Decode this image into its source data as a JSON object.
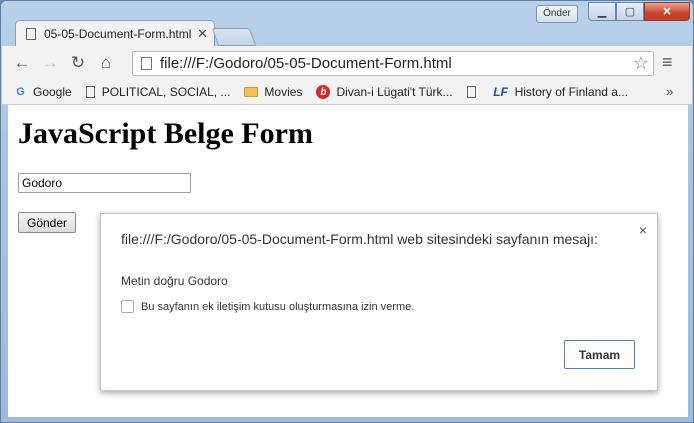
{
  "window": {
    "user_badge": "Önder",
    "min_glyph": "▁",
    "max_glyph": "▢",
    "close_glyph": "✕"
  },
  "tab": {
    "title": "05-05-Document-Form.html",
    "close_glyph": "✕"
  },
  "toolbar": {
    "back": "←",
    "forward": "→",
    "reload": "↻",
    "home": "⌂",
    "url": "file:///F:/Godoro/05-05-Document-Form.html",
    "star": "☆",
    "menu": "≡"
  },
  "bookmarks": {
    "items": [
      {
        "label": "Google",
        "icon": "google-icon"
      },
      {
        "label": "POLITICAL, SOCIAL, ...",
        "icon": "page-icon"
      },
      {
        "label": "Movies",
        "icon": "folder-icon"
      },
      {
        "label": "Divan-i Lügati't Türk...",
        "icon": "site-icon"
      },
      {
        "label": "",
        "icon": "page-icon"
      },
      {
        "label": "History of Finland a...",
        "icon": "lf-icon"
      }
    ],
    "overflow": "»"
  },
  "page": {
    "heading": "JavaScript Belge Form",
    "input_value": "Godoro",
    "submit_label": "Gönder"
  },
  "dialog": {
    "title": "file:///F:/Godoro/05-05-Document-Form.html web sitesindeki sayfanın mesajı:",
    "close_glyph": "×",
    "message": "Metin doğru Godoro",
    "checkbox_label": "Bu sayfanın ek iletişim kutusu oluşturmasına izin verme.",
    "ok_label": "Tamam"
  }
}
